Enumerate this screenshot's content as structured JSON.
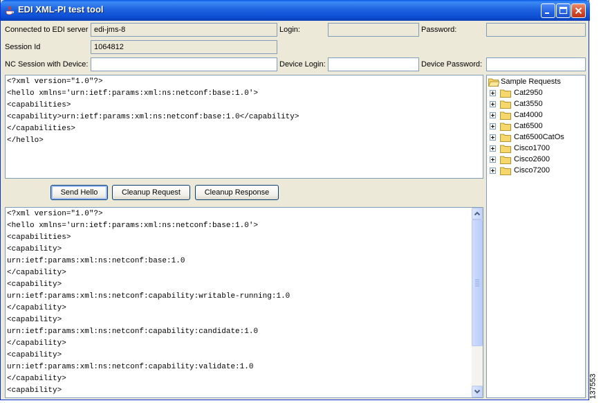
{
  "window": {
    "title": "EDI XML-PI test tool"
  },
  "connection": {
    "server_label": "Connected to EDI server",
    "server_value": "edi-jms-8",
    "login_label": "Login:",
    "login_value": "",
    "password_label": "Password:",
    "password_value": "",
    "session_label": "Session Id",
    "session_value": "1064812",
    "nc_session_label": "NC Session with Device:",
    "nc_session_value": "",
    "device_login_label": "Device Login:",
    "device_login_value": "",
    "device_password_label": "Device Password:",
    "device_password_value": ""
  },
  "request": {
    "lines": [
      "<?xml version=\"1.0\"?>",
      "<hello xmlns='urn:ietf:params:xml:ns:netconf:base:1.0'>",
      "<capabilities>",
      "<capability>urn:ietf:params:xml:ns:netconf:base:1.0</capability>",
      "</capabilities>",
      "</hello>"
    ]
  },
  "buttons": {
    "send_hello": "Send Hello",
    "cleanup_request": "Cleanup Request",
    "cleanup_response": "Cleanup Response"
  },
  "response": {
    "lines": [
      "<?xml version=\"1.0\"?>",
      "<hello xmlns='urn:ietf:params:xml:ns:netconf:base:1.0'>",
      "<capabilities>",
      "<capability>",
      "urn:ietf:params:xml:ns:netconf:base:1.0",
      "</capability>",
      "<capability>",
      "urn:ietf:params:xml:ns:netconf:capability:writable-running:1.0",
      "</capability>",
      "<capability>",
      "urn:ietf:params:xml:ns:netconf:capability:candidate:1.0",
      "</capability>",
      "<capability>",
      "urn:ietf:params:xml:ns:netconf:capability:validate:1.0",
      "</capability>",
      "<capability>"
    ]
  },
  "tree": {
    "root": "Sample Requests",
    "items": [
      "Cat2950",
      "Cat3550",
      "Cat4000",
      "Cat6500",
      "Cat6500CatOs",
      "Cisco1700",
      "Cisco2600",
      "Cisco7200"
    ]
  },
  "figure_id": "137553",
  "icons": {
    "app": "java-cup-icon",
    "minimize": "minimize-icon",
    "maximize": "maximize-icon",
    "close": "close-icon",
    "folder": "folder-icon",
    "expand": "plus-expander-icon"
  },
  "colors": {
    "titlebar": "#0a4fd6",
    "window_bg": "#ece9d8",
    "field_border": "#7f9db9",
    "folder": "#f5d66b"
  }
}
